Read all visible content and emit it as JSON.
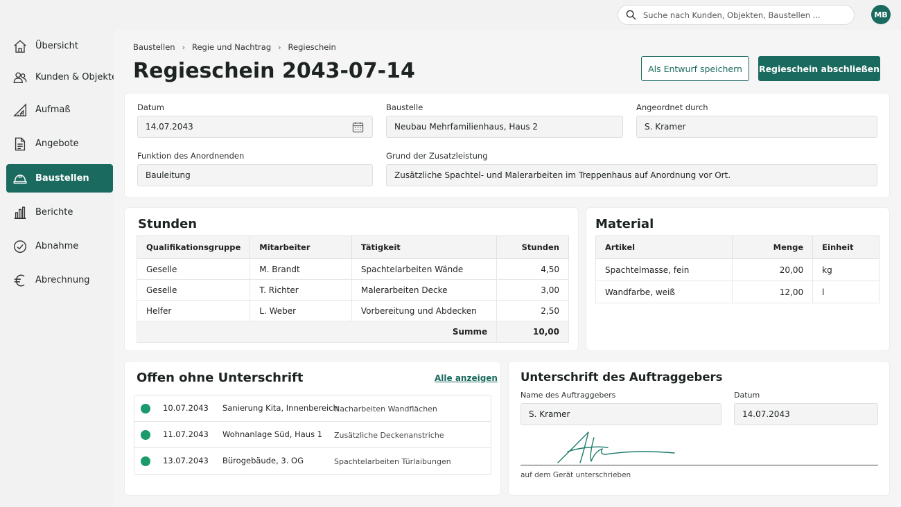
{
  "search": {
    "placeholder": "Suche nach Kunden, Objekten, Baustellen ..."
  },
  "user": {
    "initials": "MB"
  },
  "sidebar": {
    "items": [
      {
        "label": "Übersicht",
        "icon": "home-icon"
      },
      {
        "label": "Kunden & Objekte",
        "icon": "users-icon"
      },
      {
        "label": "Aufmaß",
        "icon": "ruler-triangle-icon"
      },
      {
        "label": "Angebote",
        "icon": "document-icon"
      },
      {
        "label": "Baustellen",
        "icon": "helmet-icon",
        "active": true
      },
      {
        "label": "Berichte",
        "icon": "bar-chart-icon"
      },
      {
        "label": "Abnahme",
        "icon": "check-circle-icon"
      },
      {
        "label": "Abrechnung",
        "icon": "euro-icon"
      }
    ]
  },
  "breadcrumb": [
    "Baustellen",
    "Regie und Nachtrag",
    "Regieschein"
  ],
  "page": {
    "title": "Regieschein 2043-07-14"
  },
  "actions": {
    "draft": "Als Entwurf speichern",
    "finish": "Regieschein abschließen"
  },
  "form": {
    "datum_label": "Datum",
    "datum_value": "14.07.2043",
    "baustelle_label": "Baustelle",
    "baustelle_value": "Neubau Mehrfamilienhaus, Haus 2",
    "angeordnet_label": "Angeordnet durch",
    "angeordnet_value": "S. Kramer",
    "funktion_label": "Funktion des Anordnenden",
    "funktion_value": "Bauleitung",
    "grund_label": "Grund der Zusatzleistung",
    "grund_value": "Zusätzliche Spachtel- und Malerarbeiten im Treppenhaus auf Anordnung vor Ort."
  },
  "stunden": {
    "title": "Stunden",
    "headers": [
      "Qualifikationsgruppe",
      "Mitarbeiter",
      "Tätigkeit",
      "Stunden"
    ],
    "rows": [
      [
        "Geselle",
        "M. Brandt",
        "Spachtelarbeiten Wände",
        "4,50"
      ],
      [
        "Geselle",
        "T. Richter",
        "Malerarbeiten Decke",
        "3,00"
      ],
      [
        "Helfer",
        "L. Weber",
        "Vorbereitung und Abdecken",
        "2,50"
      ]
    ],
    "sum_label": "Summe",
    "sum_value": "10,00"
  },
  "material": {
    "title": "Material",
    "headers": [
      "Artikel",
      "Menge",
      "Einheit"
    ],
    "rows": [
      [
        "Spachtelmasse, fein",
        "20,00",
        "kg"
      ],
      [
        "Wandfarbe, weiß",
        "12,00",
        "l"
      ]
    ]
  },
  "offen": {
    "title": "Offen ohne Unterschrift",
    "link": "Alle anzeigen",
    "rows": [
      {
        "date": "10.07.2043",
        "site": "Sanierung Kita, Innenbereich",
        "task": "Nacharbeiten Wandflächen",
        "status_color": "#1b9a6c"
      },
      {
        "date": "11.07.2043",
        "site": "Wohnanlage Süd, Haus 1",
        "task": "Zusätzliche Deckenanstriche",
        "status_color": "#1b9a6c"
      },
      {
        "date": "13.07.2043",
        "site": "Bürogebäude, 3. OG",
        "task": "Spachtelarbeiten Türlaibungen",
        "status_color": "#1b9a6c"
      }
    ]
  },
  "unterschrift": {
    "title": "Unterschrift des Auftraggebers",
    "name_label": "Name des Auftraggebers",
    "name_value": "S. Kramer",
    "datum_label": "Datum",
    "datum_value": "14.07.2043",
    "caption": "auf dem Gerät unterschrieben"
  },
  "colors": {
    "accent": "#1b6a5f",
    "status_ok": "#1b9a6c"
  }
}
